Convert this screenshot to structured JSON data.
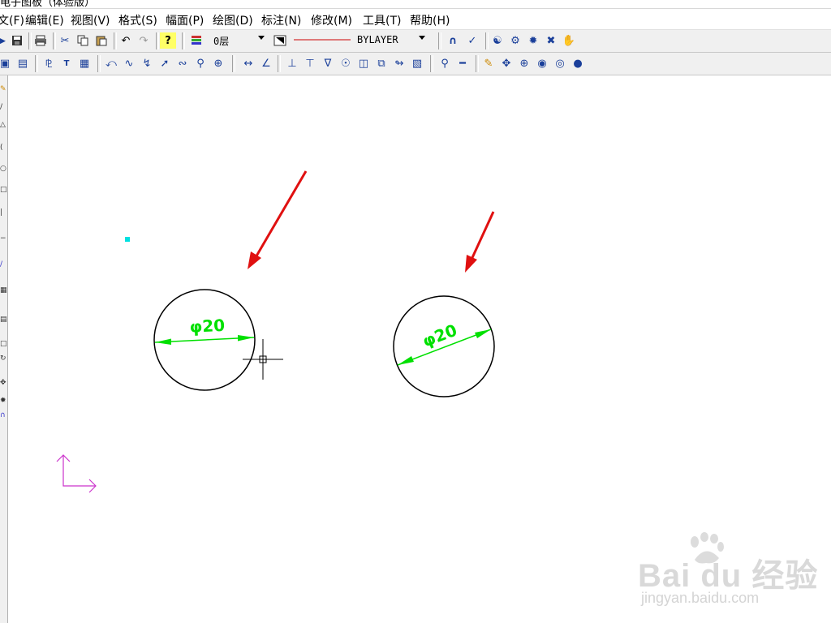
{
  "window": {
    "title": "电子图板（体验版）"
  },
  "menu": [
    {
      "label": "文(F)"
    },
    {
      "label": "编辑(E)"
    },
    {
      "label": "视图(V)"
    },
    {
      "label": "格式(S)"
    },
    {
      "label": "幅面(P)"
    },
    {
      "label": "绘图(D)"
    },
    {
      "label": "标注(N)"
    },
    {
      "label": "修改(M)"
    },
    {
      "label": "工具(T)"
    },
    {
      "label": "帮助(H)"
    }
  ],
  "toolbar": {
    "layer_value": "0层",
    "linetype_value": "BYLAYER",
    "line_color": "#cc0000"
  },
  "drawing": {
    "dim_text_left": "φ20",
    "dim_text_right": "φ20",
    "dim_color": "#00e000",
    "arrow_color": "#e01010",
    "ucs_color": "#cc33cc",
    "marker_color": "#00e0e0"
  },
  "watermark": {
    "main": "Bai  du 经验",
    "sub": "jingyan.baidu.com"
  }
}
